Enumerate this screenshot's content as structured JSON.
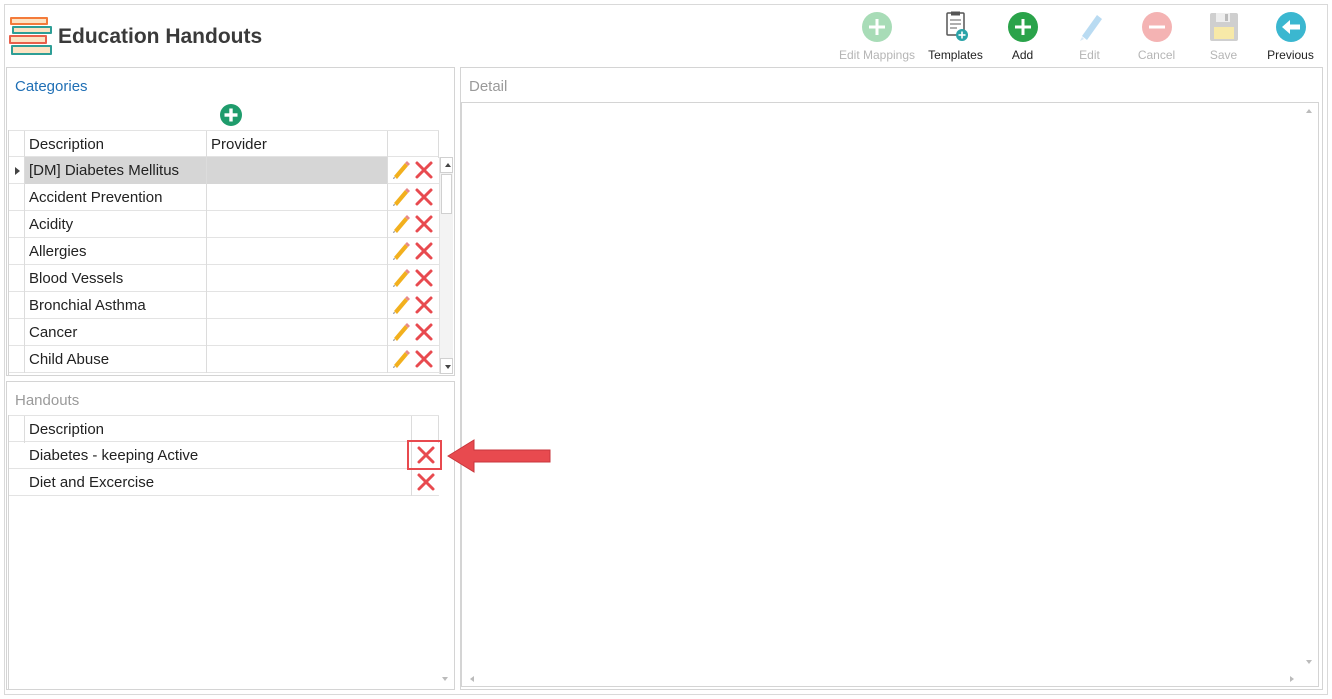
{
  "header": {
    "title": "Education Handouts",
    "app_icon": "books-stack-icon"
  },
  "toolbar": {
    "buttons": [
      {
        "label": "Edit Mappings",
        "icon": "plus-circle-icon",
        "enabled": false
      },
      {
        "label": "Templates",
        "icon": "template-document-icon",
        "enabled": true
      },
      {
        "label": "Add",
        "icon": "plus-circle-icon",
        "enabled": true
      },
      {
        "label": "Edit",
        "icon": "pencil-icon",
        "enabled": false
      },
      {
        "label": "Cancel",
        "icon": "minus-circle-icon",
        "enabled": false
      },
      {
        "label": "Save",
        "icon": "floppy-disk-icon",
        "enabled": false
      },
      {
        "label": "Previous",
        "icon": "arrow-left-circle-icon",
        "enabled": true
      }
    ]
  },
  "categories": {
    "title": "Categories",
    "add_icon": "plus-circle-icon",
    "columns": [
      "Description",
      "Provider"
    ],
    "rows": [
      {
        "description": "[DM] Diabetes Mellitus",
        "provider": "",
        "selected": true
      },
      {
        "description": "Accident Prevention",
        "provider": ""
      },
      {
        "description": "Acidity",
        "provider": ""
      },
      {
        "description": "Allergies",
        "provider": ""
      },
      {
        "description": "Blood Vessels",
        "provider": ""
      },
      {
        "description": "Bronchial Asthma",
        "provider": ""
      },
      {
        "description": "Cancer",
        "provider": ""
      },
      {
        "description": "Child Abuse",
        "provider": ""
      }
    ]
  },
  "handouts": {
    "title": "Handouts",
    "columns": [
      "Description"
    ],
    "rows": [
      {
        "description": "Diabetes - keeping Active",
        "highlighted": true
      },
      {
        "description": "Diet and Excercise"
      }
    ]
  },
  "detail": {
    "title": "Detail"
  },
  "colors": {
    "accent_blue": "#1f6fb5",
    "green": "#2aa34a",
    "delete_red": "#e84a4f",
    "pencil_yellow": "#f2b01e",
    "selection_gray": "#d6d6d6"
  }
}
